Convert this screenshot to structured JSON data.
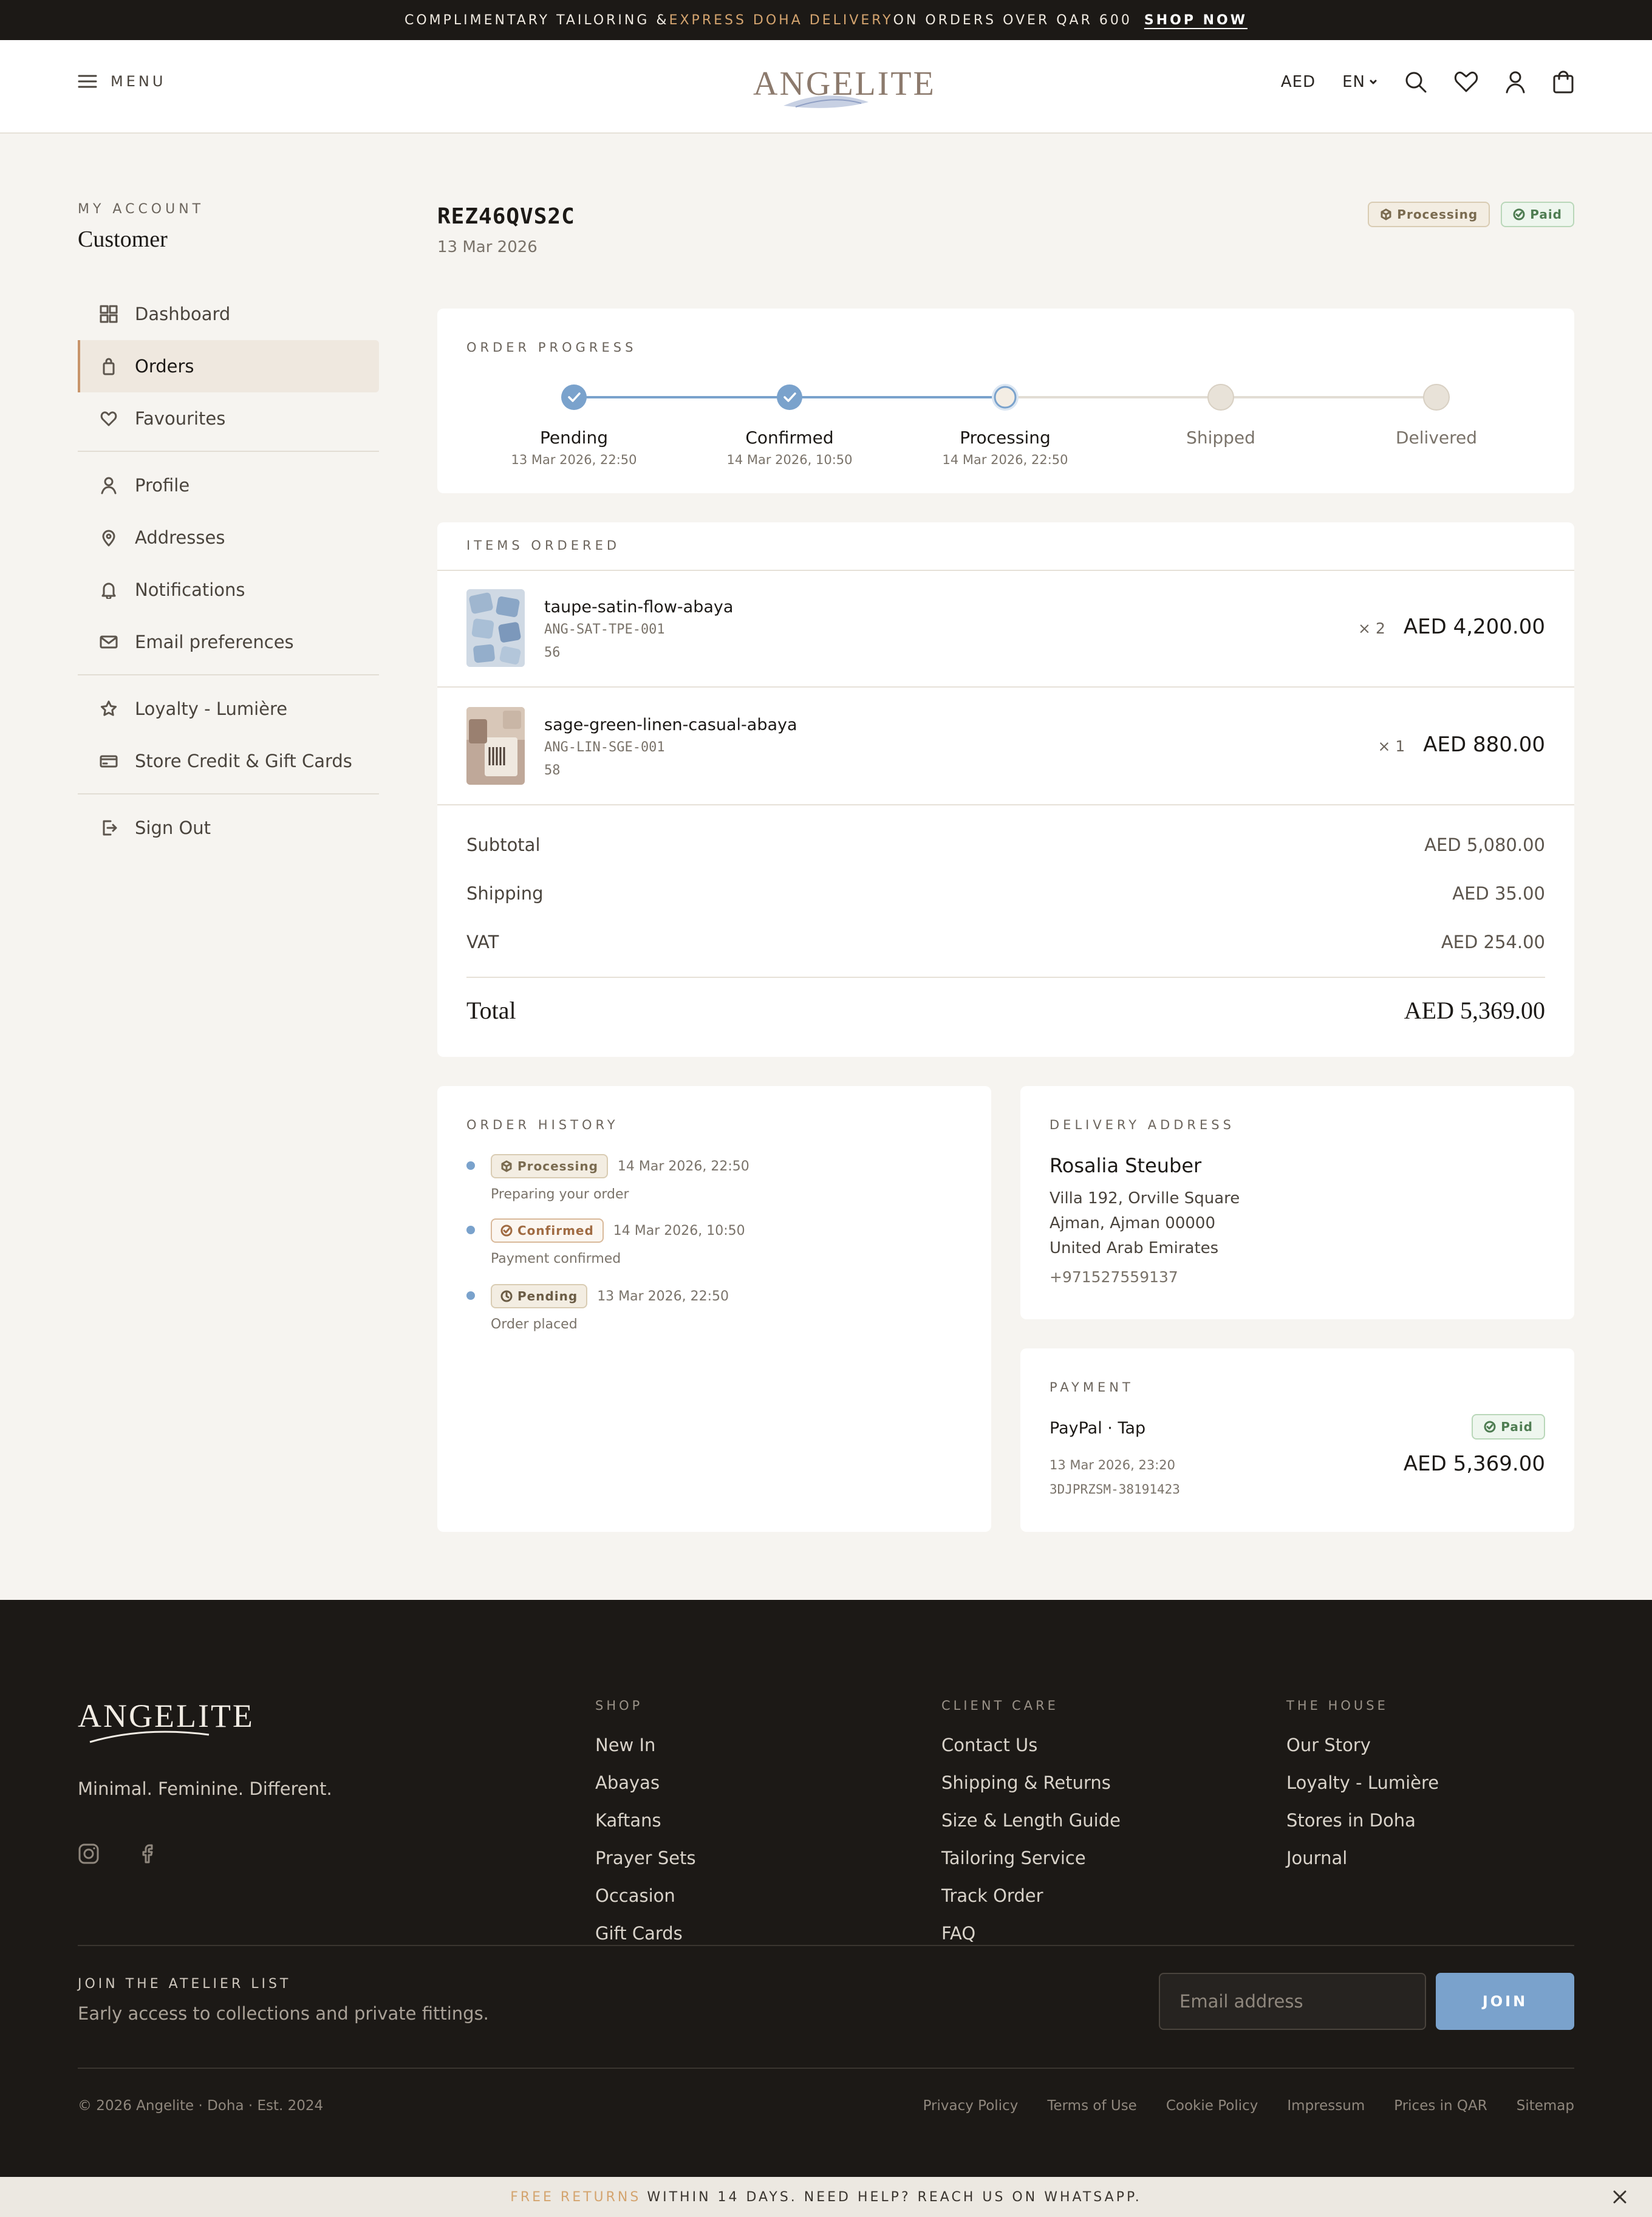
{
  "announcement": {
    "part1": "COMPLIMENTARY TAILORING & ",
    "accent": "EXPRESS DOHA DELIVERY",
    "part2": " ON ORDERS OVER QAR 600",
    "cta": "SHOP NOW"
  },
  "header": {
    "menu_label": "MENU",
    "brand": "ANGELITE",
    "currency": "AED",
    "language": "EN",
    "icons": [
      "search-icon",
      "heart-icon",
      "user-icon",
      "cart-icon"
    ]
  },
  "sidebar": {
    "section_label": "MY ACCOUNT",
    "account_name": "Customer",
    "group1": [
      {
        "label": "Dashboard",
        "icon": "grid-icon"
      },
      {
        "label": "Orders",
        "icon": "bag-icon",
        "active": true
      },
      {
        "label": "Favourites",
        "icon": "heart-icon"
      }
    ],
    "group2": [
      {
        "label": "Profile",
        "icon": "user-icon"
      },
      {
        "label": "Addresses",
        "icon": "pin-icon"
      },
      {
        "label": "Notifications",
        "icon": "bell-icon"
      },
      {
        "label": "Email preferences",
        "icon": "mail-icon"
      }
    ],
    "group3": [
      {
        "label": "Loyalty - Lumière",
        "icon": "star-icon"
      },
      {
        "label": "Store Credit & Gift Cards",
        "icon": "card-icon"
      }
    ],
    "group4": [
      {
        "label": "Sign Out",
        "icon": "signout-icon"
      }
    ]
  },
  "order": {
    "id": "REZ46QVS2C",
    "date": "13 Mar 2026",
    "status_badge": "Processing",
    "payment_badge": "Paid"
  },
  "progress": {
    "label": "ORDER PROGRESS",
    "steps": [
      {
        "name": "Pending",
        "date": "13 Mar 2026, 22:50",
        "state": "done"
      },
      {
        "name": "Confirmed",
        "date": "14 Mar 2026, 10:50",
        "state": "done"
      },
      {
        "name": "Processing",
        "date": "14 Mar 2026, 22:50",
        "state": "current"
      },
      {
        "name": "Shipped",
        "date": "",
        "state": "upcoming"
      },
      {
        "name": "Delivered",
        "date": "",
        "state": "upcoming"
      }
    ],
    "colors": {
      "done": "#7aa2cc",
      "upcoming": "#e8e2d8"
    }
  },
  "items": {
    "label": "ITEMS ORDERED",
    "list": [
      {
        "name": "taupe-satin-flow-abaya",
        "sku": "ANG-SAT-TPE-001",
        "size": "56",
        "qty": "× 2",
        "price": "AED 4,200.00"
      },
      {
        "name": "sage-green-linen-casual-abaya",
        "sku": "ANG-LIN-SGE-001",
        "size": "58",
        "qty": "× 1",
        "price": "AED 880.00"
      }
    ],
    "subtotal_label": "Subtotal",
    "subtotal": "AED 5,080.00",
    "shipping_label": "Shipping",
    "shipping": "AED 35.00",
    "vat_label": "VAT",
    "vat": "AED 254.00",
    "total_label": "Total",
    "total": "AED 5,369.00"
  },
  "history": {
    "label": "ORDER HISTORY",
    "entries": [
      {
        "status": "Processing",
        "date": "14 Mar 2026, 22:50",
        "desc": "Preparing your order"
      },
      {
        "status": "Confirmed",
        "date": "14 Mar 2026, 10:50",
        "desc": "Payment confirmed"
      },
      {
        "status": "Pending",
        "date": "13 Mar 2026, 22:50",
        "desc": "Order placed"
      }
    ]
  },
  "delivery": {
    "label": "DELIVERY ADDRESS",
    "name": "Rosalia Steuber",
    "line1": "Villa 192, Orville Square",
    "line2": "Ajman, Ajman 00000",
    "line3": "United Arab Emirates",
    "phone": "+971527559137"
  },
  "payment": {
    "label": "PAYMENT",
    "method": "PayPal · Tap",
    "badge": "Paid",
    "date": "13 Mar 2026, 23:20",
    "reference": "3DJPRZSM-38191423",
    "amount": "AED 5,369.00"
  },
  "footer": {
    "brand": "ANGELITE",
    "tagline": "Minimal. Feminine. Different.",
    "social": [
      "instagram-icon",
      "facebook-icon"
    ],
    "columns": [
      {
        "heading": "SHOP",
        "links": [
          "New In",
          "Abayas",
          "Kaftans",
          "Prayer Sets",
          "Occasion",
          "Gift Cards"
        ]
      },
      {
        "heading": "CLIENT CARE",
        "links": [
          "Contact Us",
          "Shipping & Returns",
          "Size & Length Guide",
          "Tailoring Service",
          "Track Order",
          "FAQ"
        ]
      },
      {
        "heading": "THE HOUSE",
        "links": [
          "Our Story",
          "Loyalty - Lumière",
          "Stores in Doha",
          "Journal"
        ]
      }
    ],
    "newsletter_label": "JOIN THE ATELIER LIST",
    "newsletter_sub": "Early access to collections and private fittings.",
    "email_placeholder": "Email address",
    "join_label": "JOIN",
    "copyright": "© 2026 Angelite · Doha · Est. 2024",
    "legal": [
      "Privacy Policy",
      "Terms of Use",
      "Cookie Policy",
      "Impressum",
      "Prices in QAR",
      "Sitemap"
    ]
  },
  "bottom_bar": {
    "accent": "FREE RETURNS",
    "text": "WITHIN 14 DAYS. NEED HELP? REACH US ON WHATSAPP."
  }
}
